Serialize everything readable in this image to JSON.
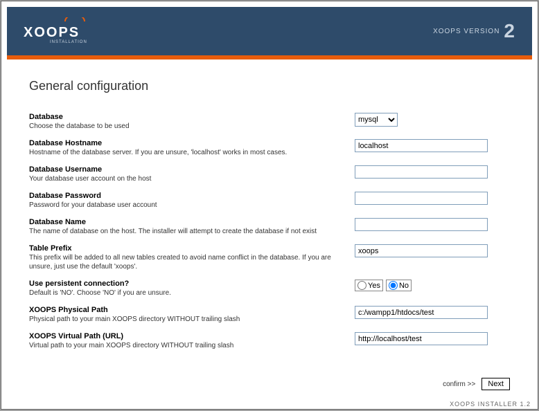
{
  "header": {
    "brand": "XOOPS",
    "brand_sub": "INSTALLATION",
    "version_label": "XOOPS VERSION",
    "version_number": "2"
  },
  "page_title": "General configuration",
  "fields": {
    "database": {
      "title": "Database",
      "desc": "Choose the database to be used",
      "selected": "mysql",
      "options": [
        "mysql"
      ]
    },
    "hostname": {
      "title": "Database Hostname",
      "desc": "Hostname of the database server. If you are unsure, 'localhost' works in most cases.",
      "value": "localhost"
    },
    "username": {
      "title": "Database Username",
      "desc": "Your database user account on the host",
      "value": ""
    },
    "password": {
      "title": "Database Password",
      "desc": "Password for your database user account",
      "value": ""
    },
    "dbname": {
      "title": "Database Name",
      "desc": "The name of database on the host. The installer will attempt to create the database if not exist",
      "value": ""
    },
    "prefix": {
      "title": "Table Prefix",
      "desc": "This prefix will be added to all new tables created to avoid name conflict in the database. If you are unsure, just use the default 'xoops'.",
      "value": "xoops"
    },
    "persistent": {
      "title": "Use persistent connection?",
      "desc": "Default is 'NO'. Choose 'NO' if you are unsure.",
      "yes_label": "Yes",
      "no_label": "No",
      "selected": "no"
    },
    "physical_path": {
      "title": "XOOPS Physical Path",
      "desc": "Physical path to your main XOOPS directory WITHOUT trailing slash",
      "value": "c:/wampp1/htdocs/test"
    },
    "virtual_path": {
      "title": "XOOPS Virtual Path (URL)",
      "desc": "Virtual path to your main XOOPS directory WITHOUT trailing slash",
      "value": "http://localhost/test"
    }
  },
  "actions": {
    "confirm_label": "confirm >>",
    "next_label": "Next"
  },
  "footer": "XOOPS INSTALLER 1.2"
}
